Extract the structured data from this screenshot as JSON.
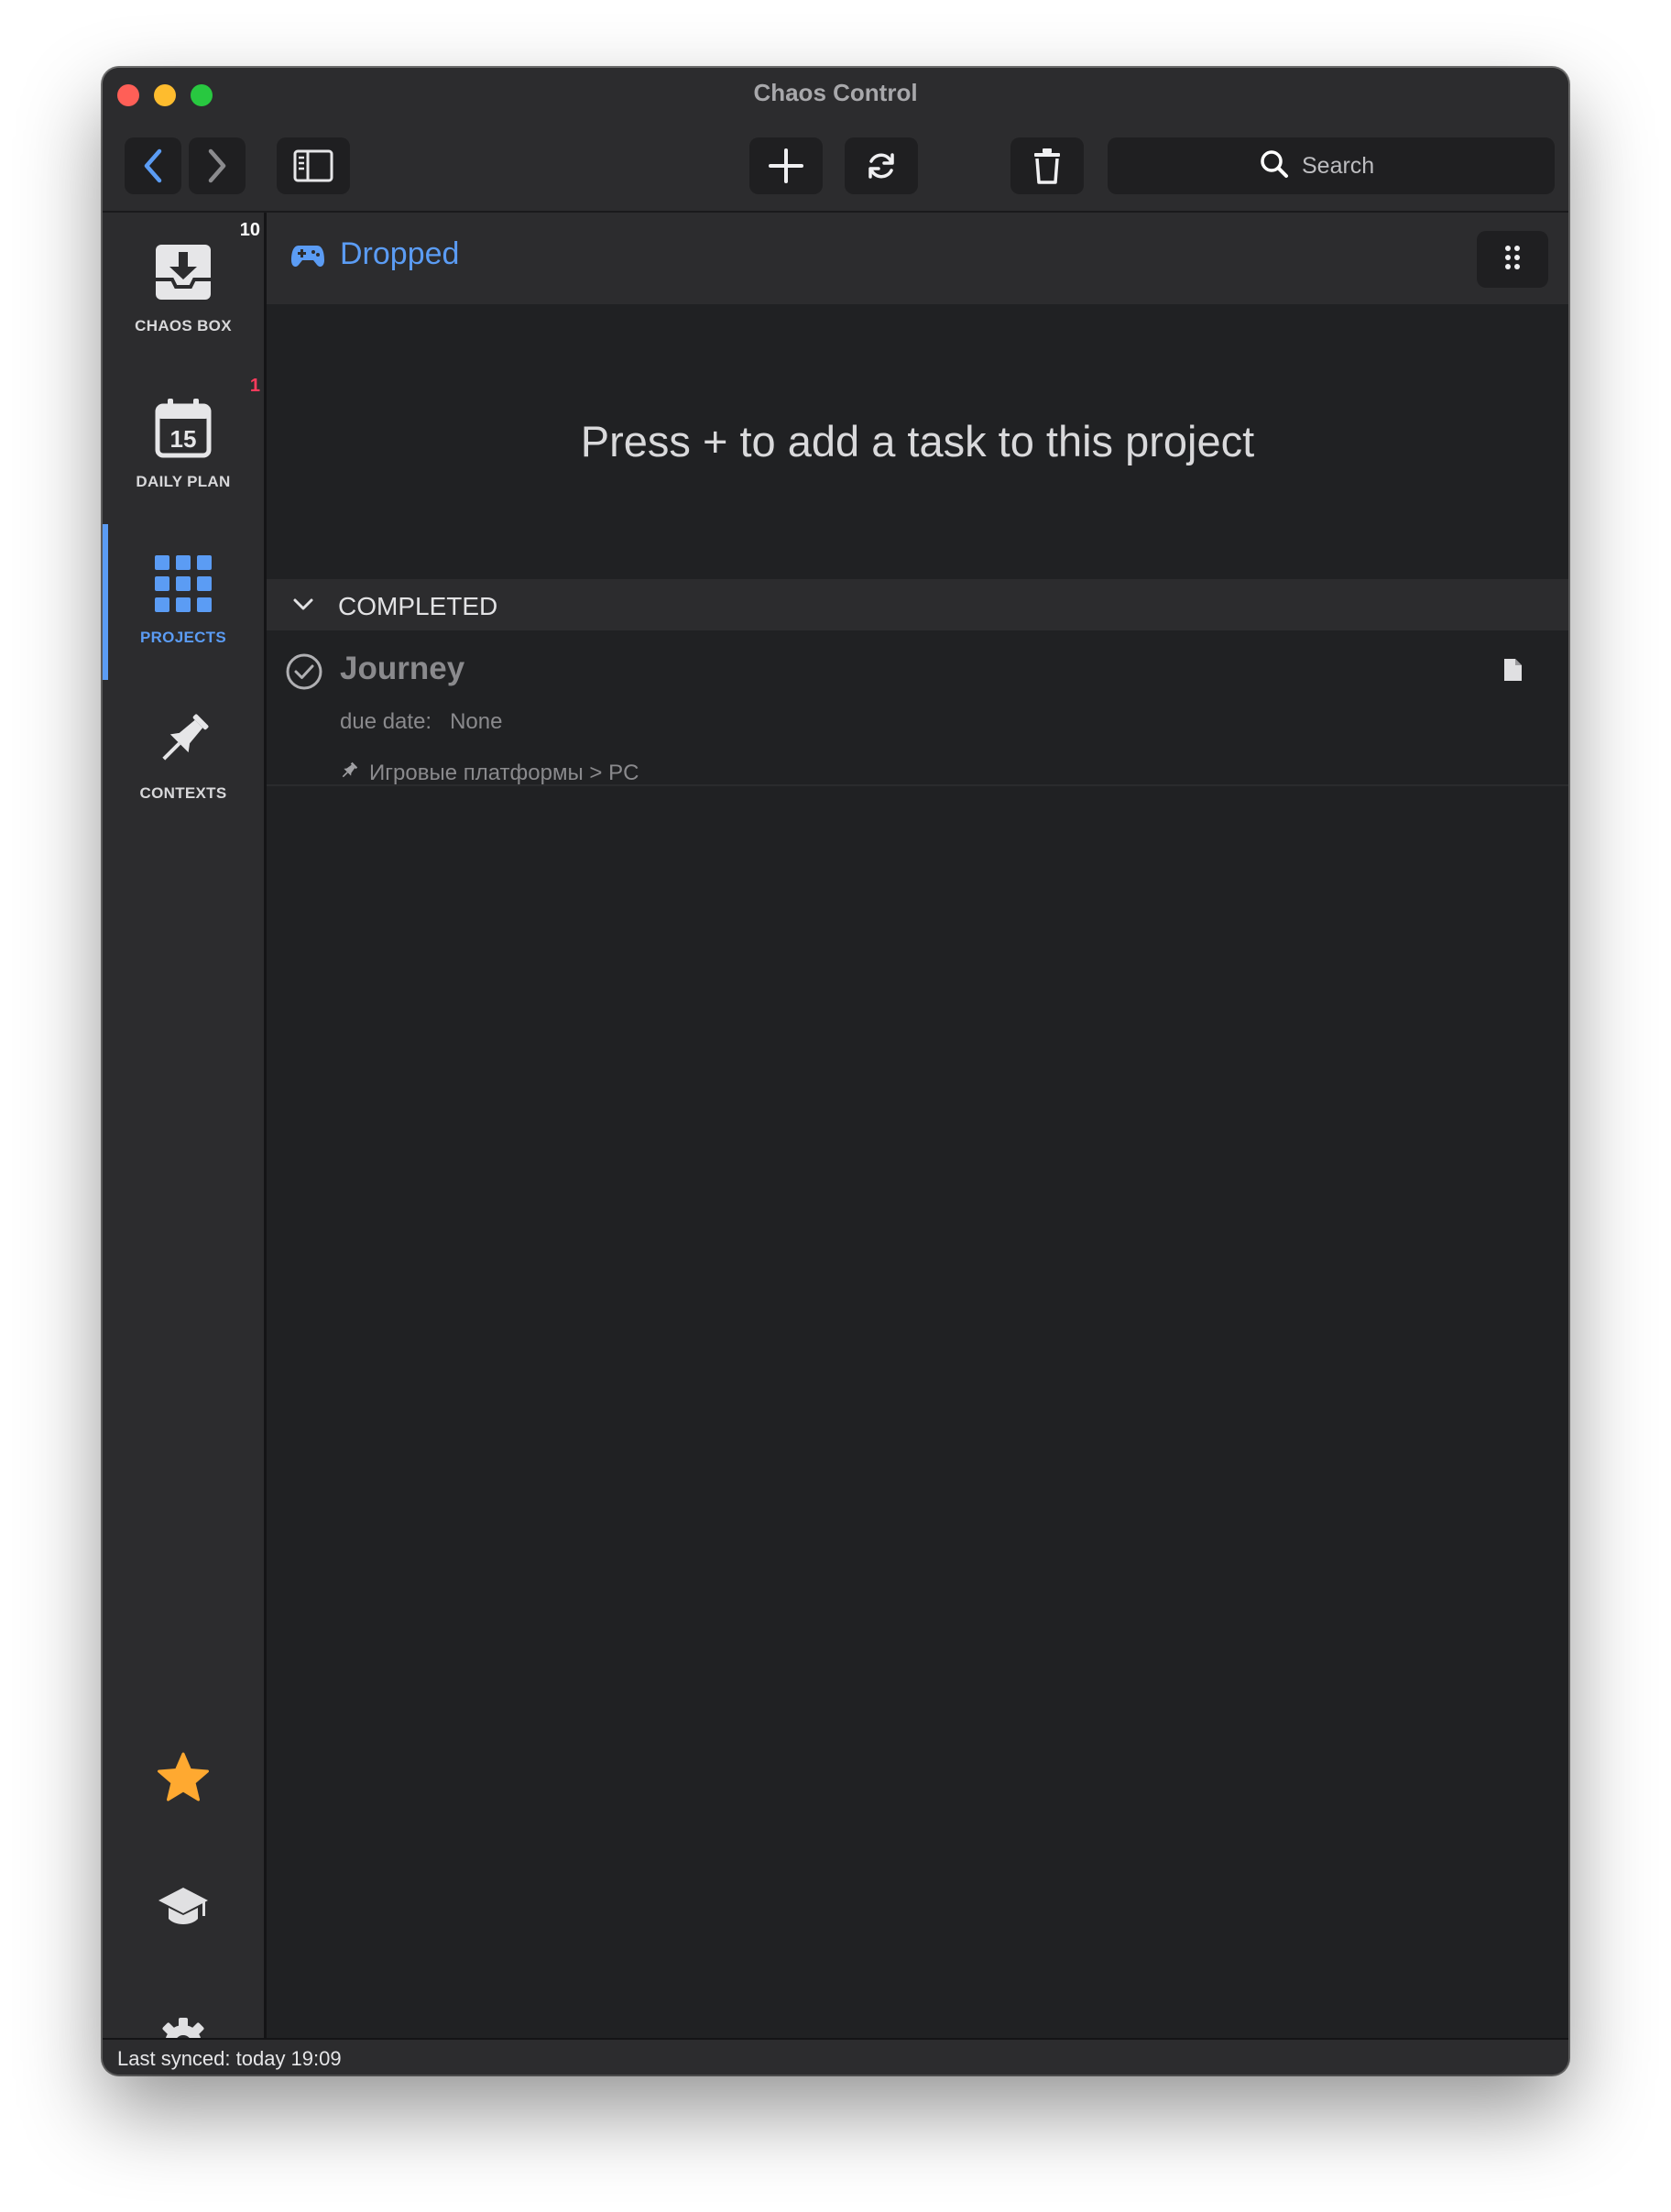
{
  "window": {
    "title": "Chaos Control"
  },
  "toolbar": {
    "back_icon": "chevron-left-icon",
    "forward_icon": "chevron-right-icon",
    "sidebar_toggle_icon": "sidebar-toggle-icon",
    "add_icon": "plus-icon",
    "sync_icon": "refresh-icon",
    "delete_icon": "trash-icon",
    "search_placeholder": "Search",
    "accent_color": "#5b9cf4"
  },
  "sidebar": {
    "items": [
      {
        "label": "CHAOS BOX",
        "icon": "inbox-download-icon",
        "badge": "10",
        "badge_color": "#ffffff",
        "active": false
      },
      {
        "label": "DAILY PLAN",
        "icon": "calendar-icon",
        "icon_text": "15",
        "badge": "1",
        "badge_color": "#ff3b5c",
        "active": false
      },
      {
        "label": "PROJECTS",
        "icon": "grid-icon",
        "badge": "",
        "active": true
      },
      {
        "label": "CONTEXTS",
        "icon": "pushpin-icon",
        "badge": "",
        "active": false
      }
    ],
    "bottom": [
      {
        "icon": "star-icon",
        "color": "#ffa930"
      },
      {
        "icon": "graduation-cap-icon",
        "color": "#e0e0e2"
      },
      {
        "icon": "gear-icon",
        "color": "#e0e0e2"
      }
    ]
  },
  "project": {
    "icon": "gamepad-icon",
    "title": "Dropped",
    "menu_icon": "grid-dots-icon",
    "empty_message": "Press + to add a task to this project"
  },
  "completed_section": {
    "label": "COMPLETED",
    "tasks": [
      {
        "title": "Journey",
        "due_label": "due date:",
        "due_value": "None",
        "context": "Игровые платформы > PC",
        "context_icon": "pushpin-icon",
        "note_icon": "document-icon"
      }
    ]
  },
  "status": {
    "text": "Last synced: today 19:09"
  }
}
